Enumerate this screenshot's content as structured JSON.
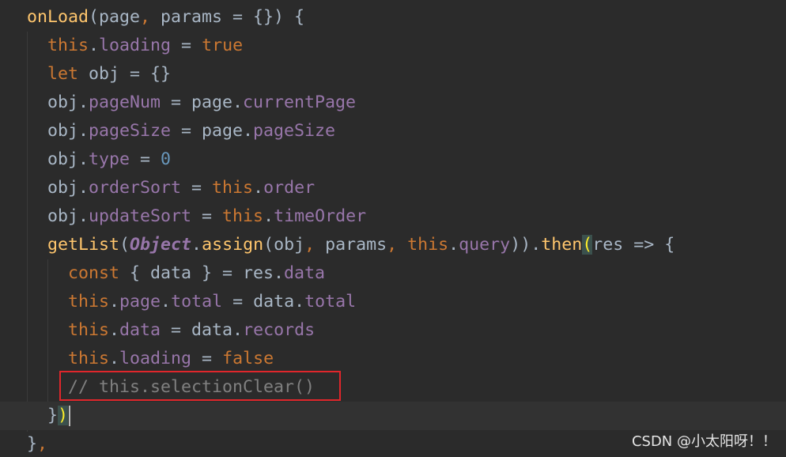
{
  "lines": [
    {
      "id": "l1",
      "tokens": [
        {
          "t": "onLoad",
          "c": "fn"
        },
        {
          "t": "(page",
          "c": "plain"
        },
        {
          "t": ", ",
          "c": "kw"
        },
        {
          "t": "params = {}) {",
          "c": "plain"
        }
      ]
    },
    {
      "id": "l2",
      "tokens": [
        {
          "t": "this",
          "c": "kw"
        },
        {
          "t": ".",
          "c": "plain"
        },
        {
          "t": "loading",
          "c": "prop"
        },
        {
          "t": " = ",
          "c": "plain"
        },
        {
          "t": "true",
          "c": "kw"
        }
      ]
    },
    {
      "id": "l3",
      "tokens": [
        {
          "t": "let ",
          "c": "kw"
        },
        {
          "t": "obj = {}",
          "c": "plain"
        }
      ]
    },
    {
      "id": "l4",
      "tokens": [
        {
          "t": "obj.",
          "c": "plain"
        },
        {
          "t": "pageNum",
          "c": "prop"
        },
        {
          "t": " = page.",
          "c": "plain"
        },
        {
          "t": "currentPage",
          "c": "prop"
        }
      ]
    },
    {
      "id": "l5",
      "tokens": [
        {
          "t": "obj.",
          "c": "plain"
        },
        {
          "t": "pageSize",
          "c": "prop"
        },
        {
          "t": " = page.",
          "c": "plain"
        },
        {
          "t": "pageSize",
          "c": "prop"
        }
      ]
    },
    {
      "id": "l6",
      "tokens": [
        {
          "t": "obj.",
          "c": "plain"
        },
        {
          "t": "type",
          "c": "prop"
        },
        {
          "t": " = ",
          "c": "plain"
        },
        {
          "t": "0",
          "c": "num"
        }
      ]
    },
    {
      "id": "l7",
      "tokens": [
        {
          "t": "obj.",
          "c": "plain"
        },
        {
          "t": "orderSort",
          "c": "prop"
        },
        {
          "t": " = ",
          "c": "plain"
        },
        {
          "t": "this",
          "c": "kw"
        },
        {
          "t": ".",
          "c": "plain"
        },
        {
          "t": "order",
          "c": "prop"
        }
      ]
    },
    {
      "id": "l8",
      "tokens": [
        {
          "t": "obj.",
          "c": "plain"
        },
        {
          "t": "updateSort",
          "c": "prop"
        },
        {
          "t": " = ",
          "c": "plain"
        },
        {
          "t": "this",
          "c": "kw"
        },
        {
          "t": ".",
          "c": "plain"
        },
        {
          "t": "timeOrder",
          "c": "prop"
        }
      ]
    },
    {
      "id": "l9",
      "tokens": [
        {
          "t": "getList",
          "c": "fn"
        },
        {
          "t": "(",
          "c": "plain"
        },
        {
          "t": "Object",
          "c": "obj"
        },
        {
          "t": ".",
          "c": "plain"
        },
        {
          "t": "assign",
          "c": "fn"
        },
        {
          "t": "(obj",
          "c": "plain"
        },
        {
          "t": ", ",
          "c": "kw"
        },
        {
          "t": "params",
          "c": "plain"
        },
        {
          "t": ", ",
          "c": "kw"
        },
        {
          "t": "this",
          "c": "kw"
        },
        {
          "t": ".",
          "c": "plain"
        },
        {
          "t": "query",
          "c": "prop"
        },
        {
          "t": ")).",
          "c": "plain"
        },
        {
          "t": "then",
          "c": "fn"
        },
        {
          "t": "(",
          "c": "bracket-hl-yellow"
        },
        {
          "t": "res => {",
          "c": "plain"
        }
      ]
    },
    {
      "id": "l10",
      "tokens": [
        {
          "t": "const ",
          "c": "kw"
        },
        {
          "t": "{ data } = res.",
          "c": "plain"
        },
        {
          "t": "data",
          "c": "prop"
        }
      ]
    },
    {
      "id": "l11",
      "tokens": [
        {
          "t": "this",
          "c": "kw"
        },
        {
          "t": ".",
          "c": "plain"
        },
        {
          "t": "page",
          "c": "prop"
        },
        {
          "t": ".",
          "c": "plain"
        },
        {
          "t": "total",
          "c": "prop"
        },
        {
          "t": " = data.",
          "c": "plain"
        },
        {
          "t": "total",
          "c": "prop"
        }
      ]
    },
    {
      "id": "l12",
      "tokens": [
        {
          "t": "this",
          "c": "kw"
        },
        {
          "t": ".",
          "c": "plain"
        },
        {
          "t": "data",
          "c": "prop"
        },
        {
          "t": " = data.",
          "c": "plain"
        },
        {
          "t": "records",
          "c": "prop"
        }
      ]
    },
    {
      "id": "l13",
      "tokens": [
        {
          "t": "this",
          "c": "kw"
        },
        {
          "t": ".",
          "c": "plain"
        },
        {
          "t": "loading",
          "c": "prop"
        },
        {
          "t": " = ",
          "c": "plain"
        },
        {
          "t": "false",
          "c": "kw"
        }
      ]
    },
    {
      "id": "l14",
      "tokens": [
        {
          "t": "// this.selectionClear()",
          "c": "comment"
        }
      ]
    },
    {
      "id": "l15",
      "tokens": [
        {
          "t": "}",
          "c": "plain"
        },
        {
          "t": ")",
          "c": "bracket-hl-yellow"
        }
      ]
    },
    {
      "id": "l16",
      "tokens": [
        {
          "t": "}",
          "c": "plain"
        },
        {
          "t": ",",
          "c": "kw"
        }
      ]
    }
  ],
  "watermark": "CSDN @小太阳呀！！"
}
